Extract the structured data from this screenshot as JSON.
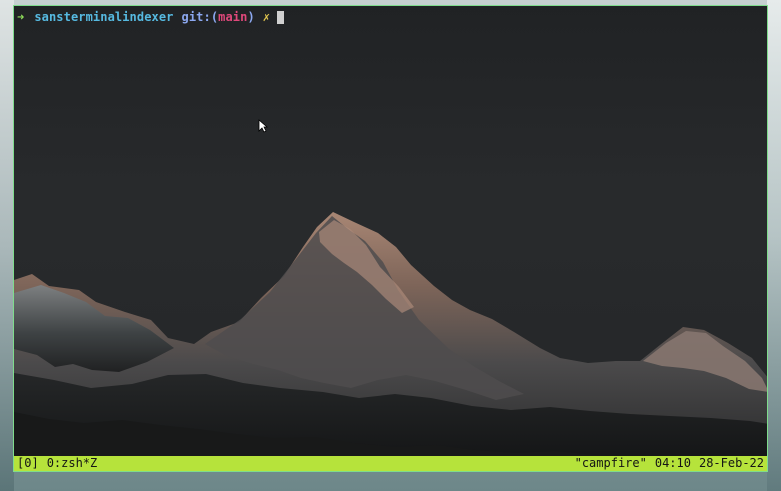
{
  "terminal": {
    "prompt_arrow": "➜",
    "directory": "sansterminalindexer",
    "git_label": "git:",
    "branch_open": "(",
    "branch": "main",
    "branch_close": ")",
    "dirty_marker": "✗"
  },
  "status_bar": {
    "session": "[0]",
    "window": "0:zsh*Z",
    "host": "\"campfire\"",
    "time": "04:10",
    "date": "28-Feb-22"
  },
  "colors": {
    "terminal_border": "#7fdc8c",
    "status_bar_bg": "#b6e33b",
    "prompt_arrow": "#8edb5a",
    "directory": "#56b9e0",
    "branch": "#e0487b",
    "dirty_marker": "#e5c94f"
  },
  "icons": {
    "pointer": "mouse-pointer-icon"
  }
}
